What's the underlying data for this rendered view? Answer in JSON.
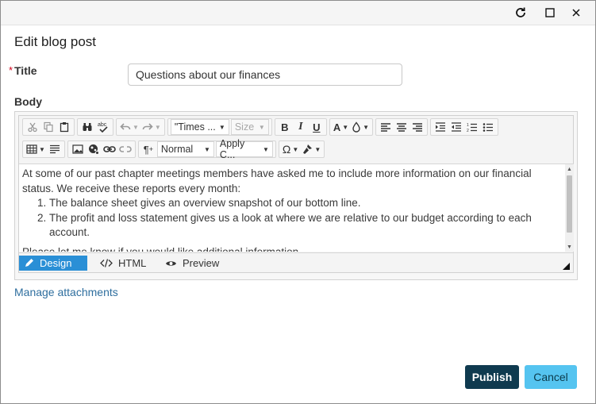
{
  "dialog": {
    "title": "Edit blog post"
  },
  "form": {
    "title_label": "Title",
    "required_marker": "*",
    "title_value": "Questions about our finances",
    "body_label": "Body"
  },
  "toolbar": {
    "font_name": "\"Times ...",
    "font_size": "Size",
    "paragraph_format": "Normal",
    "apply_css": "Apply C...",
    "paragraph_mark": "¶",
    "bold": "B",
    "italic": "I",
    "underline": "U",
    "font_color": "A",
    "omega": "Ω",
    "icons": [
      "cut-icon",
      "copy-icon",
      "paste-icon",
      "find-icon",
      "spellcheck-icon",
      "undo-icon",
      "redo-icon",
      "font-color-icon",
      "highlight-icon",
      "align-left-icon",
      "align-center-icon",
      "align-right-icon",
      "indent-icon",
      "outdent-icon",
      "numbered-list-icon",
      "bulleted-list-icon",
      "table-icon",
      "paragraph-icon",
      "image-icon",
      "media-icon",
      "link-icon",
      "unlink-icon",
      "special-chars-icon",
      "format-stripper-icon"
    ]
  },
  "content": {
    "intro": "At some of our past chapter meetings members have asked me to include more information on our financial status. We receive these reports every month:",
    "list": [
      "The balance sheet gives an overview snapshot of our bottom line.",
      "The profit and loss statement gives us a look at where we are relative to our budget according to each account."
    ],
    "tail": "Please let me know if you would like additional information."
  },
  "modes": {
    "design": "Design",
    "html": "HTML",
    "preview": "Preview",
    "active": "Design"
  },
  "links": {
    "manage_attachments": "Manage attachments"
  },
  "buttons": {
    "publish": "Publish",
    "cancel": "Cancel"
  },
  "colors": {
    "publish_bg": "#0f3a4f",
    "cancel_bg": "#55c4f0",
    "active_mode": "#2a8fd6",
    "link": "#2e6e9e",
    "required": "#d0021b"
  }
}
